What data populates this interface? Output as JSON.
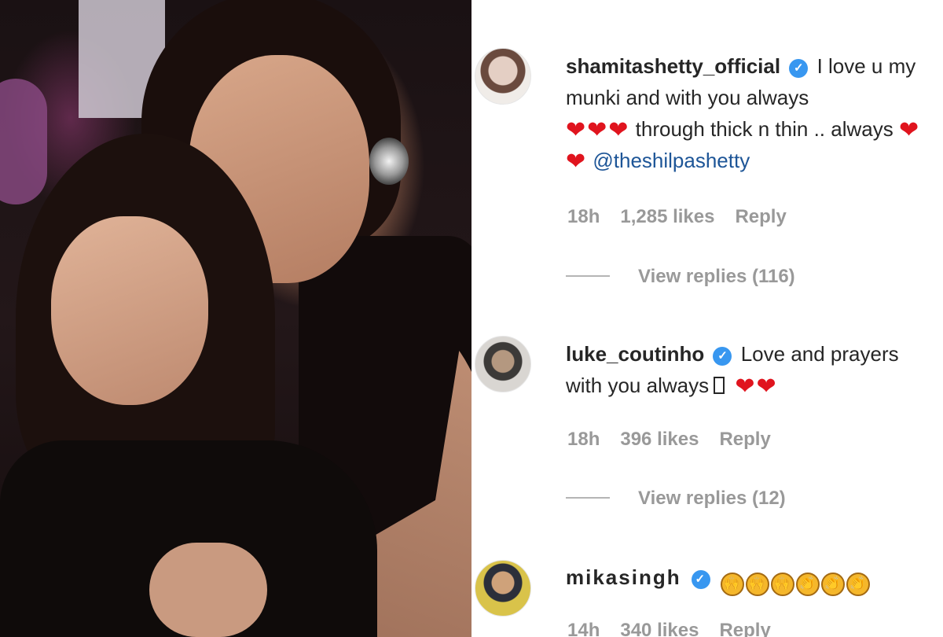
{
  "photo": {
    "alt_semantic": "two-women-photo"
  },
  "comments": [
    {
      "username": "shamitashetty_official",
      "verified": true,
      "text_parts": [
        "I love u my munki and with you always",
        "through thick n thin .. always"
      ],
      "hearts_first": 3,
      "hearts_second": 2,
      "mention": "@theshilpashetty",
      "time": "18h",
      "likes": "1,285 likes",
      "reply_label": "Reply",
      "view_replies": "View replies (116)"
    },
    {
      "username": "luke_coutinho",
      "verified": true,
      "text_parts": [
        "Love and prayers with you always"
      ],
      "hearts_first": 2,
      "time": "18h",
      "likes": "396 likes",
      "reply_label": "Reply",
      "view_replies": "View replies (12)"
    },
    {
      "username": "mikasingh",
      "verified": true,
      "emojis": [
        "pray-hands",
        "pray-hands",
        "pray-hands",
        "clap-hands",
        "clap-hands",
        "clap-hands"
      ],
      "time": "14h",
      "likes": "340 likes",
      "reply_label": "Reply"
    }
  ],
  "colors": {
    "text": "#262626",
    "meta": "#999999",
    "verified": "#3897f0",
    "heart": "#e0141e",
    "mention": "#1d5597"
  }
}
